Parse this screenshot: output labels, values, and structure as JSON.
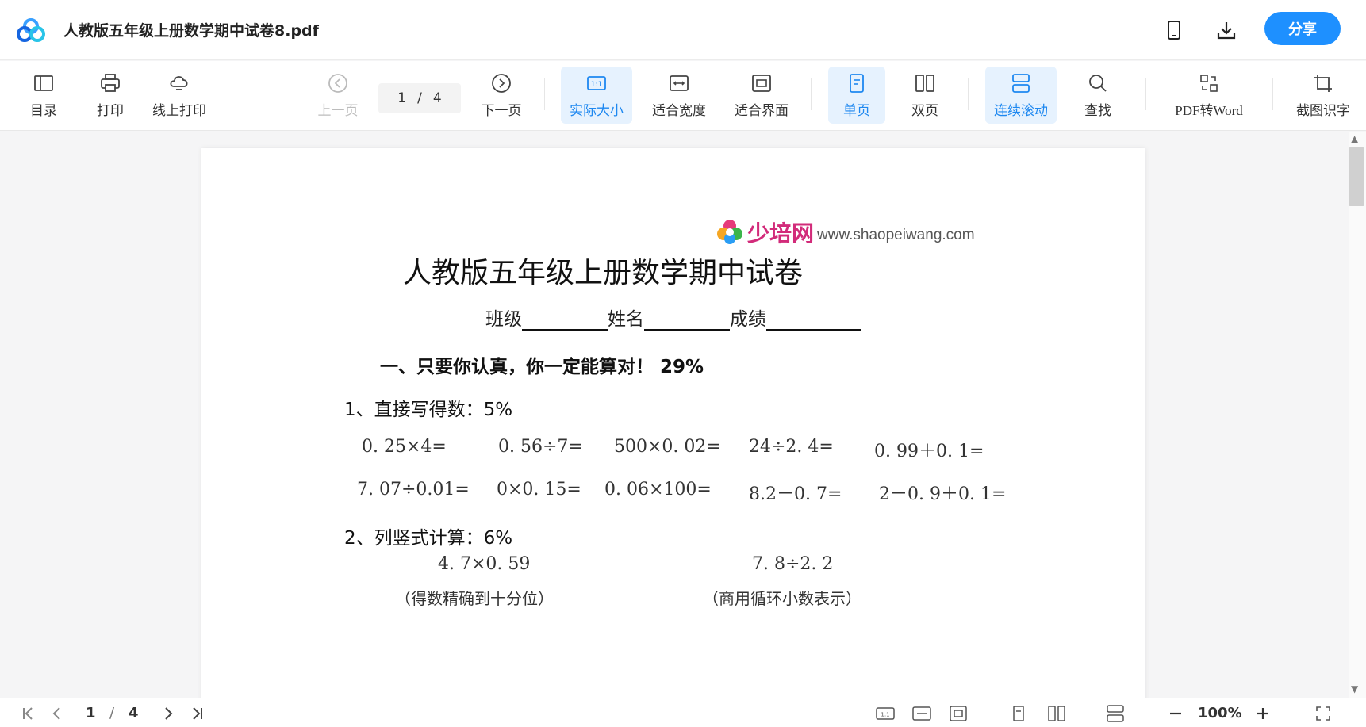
{
  "header": {
    "file_name": "人教版五年级上册数学期中试卷8.pdf",
    "share_label": "分享",
    "accent": "#1e90ff"
  },
  "toolbar": {
    "toc": "目录",
    "print": "打印",
    "online_print": "线上打印",
    "prev_page": "上一页",
    "current_page": "1",
    "page_sep": "/",
    "total_pages": "4",
    "next_page": "下一页",
    "actual_size": "实际大小",
    "fit_width": "适合宽度",
    "fit_screen": "适合界面",
    "single_page": "单页",
    "double_page": "双页",
    "continuous": "连续滚动",
    "find": "查找",
    "pdf_to_word": "PDF转Word",
    "ocr": "截图识字"
  },
  "document": {
    "logo_brand": "少培网",
    "logo_url": "www.shaopeiwang.com",
    "title": "人教版五年级上册数学期中试卷",
    "field_class": "班级",
    "field_name": "姓名",
    "field_score": "成绩",
    "section1": "一、只要你认真，你一定能算对！ 29%",
    "q1": "1、直接写得数：5%",
    "row1": [
      "0. 25×4=",
      "0. 56÷7=",
      "500×0. 02=",
      "24÷2. 4=",
      "0. 99＋0. 1="
    ],
    "row2": [
      "7. 07÷0.01=",
      "0×0. 15=",
      "0. 06×100=",
      "8.2－0. 7=",
      "2－0. 9＋0. 1="
    ],
    "q2": "2、列竖式计算：6%",
    "calc1": "4. 7×0. 59",
    "calc2": "7. 8÷2. 2",
    "note1": "（得数精确到十分位）",
    "note2": "（商用循环小数表示）"
  },
  "statusbar": {
    "current_page": "1",
    "page_sep": "/",
    "total_pages": "4",
    "zoom": "100%"
  }
}
